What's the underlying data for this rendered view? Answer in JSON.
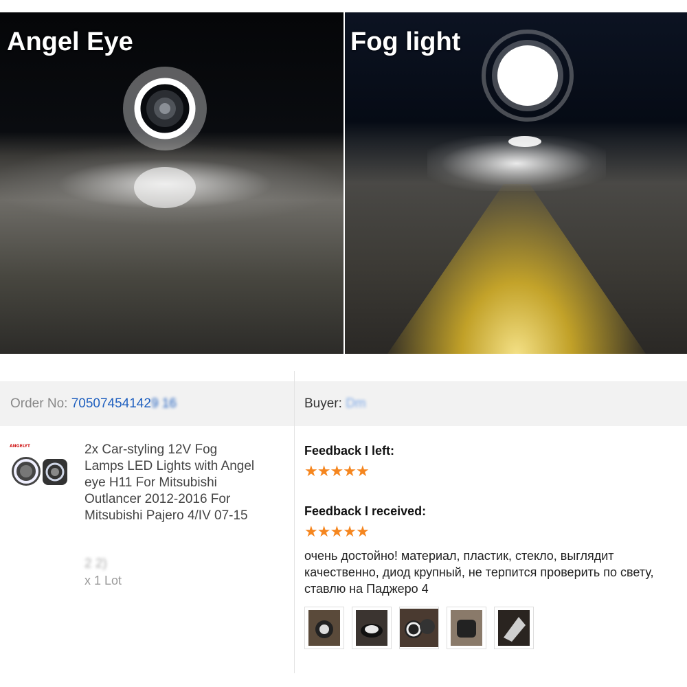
{
  "photos": {
    "left_caption": "Angel Eye",
    "right_caption": "Fog light"
  },
  "order": {
    "label": "Order No:",
    "number": "70507454142",
    "number_masked": "9   16",
    "buyer_label": "Buyer:",
    "buyer_masked": "Dm     "
  },
  "product": {
    "brand": "ANGELYT",
    "title": "2x Car-styling 12V Fog Lamps LED Lights with Angel eye H11 For Mitsubishi Outlancer 2012-2016 For Mitsubishi Pajero 4/IV 07-15",
    "sku_masked": "2                    2)",
    "quantity": "x 1 Lot"
  },
  "feedback": {
    "left_heading": "Feedback I left:",
    "left_rating": 5,
    "received_heading": "Feedback I received:",
    "received_rating": 5,
    "review_text": "очень достойно! материал, пластик, стекло, выглядит качественно, диод крупный, не терпится проверить по свету, ставлю на Паджеро 4",
    "star_color": "#f5861f",
    "photo_count": 5
  }
}
